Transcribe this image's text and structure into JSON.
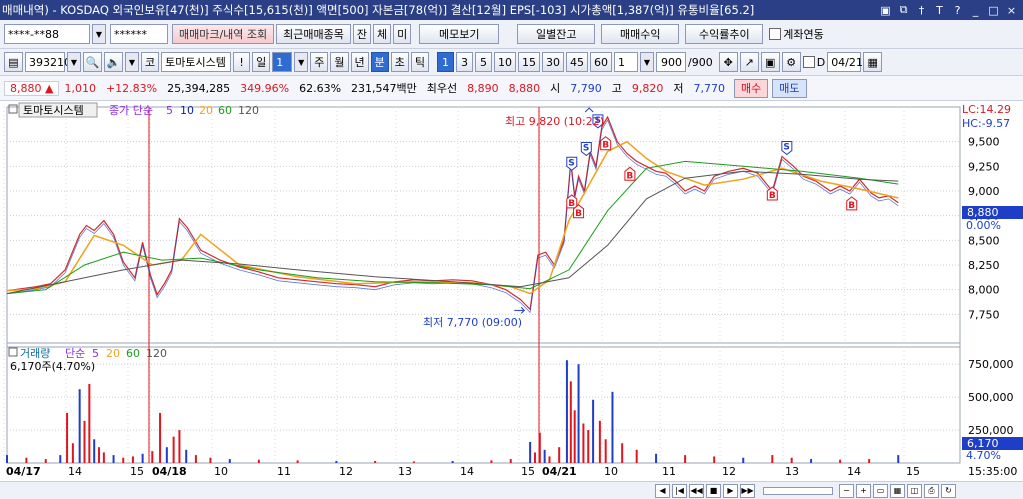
{
  "window": {
    "title": "매매내역) - KOSDAQ 외국인보유[47(천)] 주식수[15,615(천)] 액면[500] 자본금[78(억)] 결산[12월] EPS[-103] 시가총액[1,387(억)] 유통비율[65.2]",
    "buttons": [
      "▣",
      "⧉",
      "†",
      "T",
      "?",
      "_",
      "□",
      "×"
    ]
  },
  "toolbar1": {
    "account": "****-**88",
    "password": "******",
    "btn_trade_mark": "매매마크/내역 조회",
    "btn_recent": "최근매매종목",
    "btn_jan": "잔",
    "btn_che": "체",
    "btn_mi": "미",
    "btn_memo": "메모보기",
    "btn_daily": "일별잔고",
    "btn_profit": "매매수익",
    "btn_trend": "수익률추이",
    "chk_account": "계좌연동"
  },
  "toolbar2": {
    "code": "393210",
    "market": "코",
    "stock_name": "토마토시스템",
    "excl": "!",
    "period_label": "일",
    "period_value": "1",
    "p_week": "주",
    "p_month": "월",
    "p_year": "년",
    "p_min": "분",
    "p_sec": "초",
    "p_tick": "틱",
    "intervals": [
      "1",
      "3",
      "5",
      "10",
      "15",
      "30",
      "45",
      "60"
    ],
    "interval_value": "1",
    "count": "900",
    "count_total": "/900",
    "chk_d": "D",
    "date": "04/21"
  },
  "quote": {
    "price": "8,880",
    "arrow": "▲",
    "change": "1,010",
    "change_pct": "+12.83%",
    "volume": "25,394,285",
    "vol_ratio": "349.96%",
    "turnover": "62.63%",
    "amount": "231,547백만",
    "best_label": "최우선",
    "best_ask": "8,890",
    "best_bid": "8,880",
    "open_label": "시",
    "open": "7,790",
    "high_label": "고",
    "high": "9,820",
    "low_label": "저",
    "low": "7,770",
    "buy": "매수",
    "sell": "매도"
  },
  "chart_data": {
    "type": "line",
    "title": "토마토시스템",
    "price_panel": {
      "legend": {
        "name": "토마토시스템",
        "ma_label": "종가 단순",
        "periods": [
          "5",
          "10",
          "20",
          "60",
          "120"
        ]
      },
      "ylim": [
        7500,
        9750
      ],
      "yticks": [
        "9,500",
        "9,250",
        "9,000",
        "8,750",
        "8,500",
        "8,250",
        "8,000",
        "7,750"
      ],
      "lc_label": "LC:14.29",
      "hc_label": "HC:-9.57",
      "current_label": "8,880",
      "pct_label": "0.00%",
      "high_annot": "최고 9,820 (10:22)",
      "low_annot": "최저 7,770 (09:00)",
      "series": [
        {
          "name": "price",
          "x": [
            0,
            15,
            30,
            45,
            60,
            75,
            82,
            90,
            100,
            110,
            120,
            132,
            140,
            148,
            155,
            163,
            170,
            178,
            186,
            200,
            220,
            240,
            260,
            280,
            300,
            320,
            340,
            360,
            380,
            400,
            420,
            440,
            460,
            480,
            500,
            515,
            530,
            540,
            548,
            556,
            565,
            575,
            582,
            586,
            590,
            596,
            602,
            608,
            614,
            620,
            630,
            640,
            650,
            660,
            670,
            680,
            690,
            700,
            710,
            720,
            730,
            745,
            760,
            775,
            790,
            800,
            812,
            822,
            835,
            850,
            860,
            870,
            880,
            892,
            900,
            910,
            920
          ],
          "y": [
            7990,
            8010,
            8030,
            8060,
            8200,
            8560,
            8650,
            8600,
            8700,
            8560,
            8280,
            8120,
            8480,
            8150,
            7950,
            8070,
            8200,
            8720,
            8630,
            8400,
            8300,
            8230,
            8180,
            8120,
            8100,
            8080,
            8060,
            8050,
            8030,
            8080,
            8100,
            8090,
            8100,
            8090,
            8050,
            8000,
            7900,
            7800,
            8350,
            8380,
            8250,
            8500,
            9300,
            8950,
            9150,
            9000,
            9400,
            9250,
            9650,
            9750,
            9500,
            9380,
            9300,
            9250,
            9200,
            9180,
            9100,
            9000,
            9050,
            9000,
            9150,
            9200,
            9230,
            9180,
            9000,
            9350,
            9250,
            9150,
            9100,
            9000,
            9050,
            9000,
            9120,
            8980,
            8930,
            8950,
            8880
          ]
        },
        {
          "name": "ma20",
          "x": [
            0,
            30,
            60,
            90,
            120,
            150,
            180,
            200,
            240,
            300,
            360,
            420,
            480,
            520,
            540,
            560,
            580,
            600,
            620,
            640,
            660,
            680,
            720,
            760,
            800,
            840,
            880,
            920
          ],
          "y": [
            7990,
            8010,
            8080,
            8550,
            8450,
            8250,
            8300,
            8560,
            8250,
            8130,
            8060,
            8080,
            8070,
            8030,
            7960,
            8100,
            8700,
            9050,
            9400,
            9500,
            9330,
            9200,
            9060,
            9120,
            9230,
            9100,
            9020,
            8930
          ]
        },
        {
          "name": "ma60",
          "x": [
            0,
            40,
            80,
            120,
            160,
            200,
            260,
            320,
            380,
            440,
            500,
            540,
            580,
            620,
            660,
            700,
            760,
            820,
            880,
            920
          ],
          "y": [
            7960,
            8000,
            8250,
            8380,
            8300,
            8320,
            8200,
            8120,
            8080,
            8070,
            8050,
            8010,
            8200,
            8800,
            9230,
            9300,
            9250,
            9200,
            9130,
            9070
          ]
        },
        {
          "name": "ma120",
          "x": [
            0,
            60,
            120,
            180,
            240,
            300,
            380,
            460,
            530,
            580,
            620,
            660,
            700,
            760,
            820,
            880,
            920
          ],
          "y": [
            7960,
            8080,
            8200,
            8300,
            8260,
            8200,
            8130,
            8080,
            8030,
            8120,
            8450,
            8920,
            9130,
            9200,
            9170,
            9120,
            9100
          ]
        }
      ],
      "markers": [
        {
          "type": "S",
          "x": 583,
          "y": 9220
        },
        {
          "type": "B",
          "x": 583,
          "y": 8950
        },
        {
          "type": "B",
          "x": 590,
          "y": 8850
        },
        {
          "type": "S",
          "x": 598,
          "y": 9370
        },
        {
          "type": "S",
          "x": 610,
          "y": 9650
        },
        {
          "type": "B",
          "x": 618,
          "y": 9540
        },
        {
          "type": "B",
          "x": 643,
          "y": 9230
        },
        {
          "type": "B",
          "x": 790,
          "y": 9030
        },
        {
          "type": "S",
          "x": 805,
          "y": 9380
        },
        {
          "type": "B",
          "x": 872,
          "y": 8930
        }
      ]
    },
    "volume_panel": {
      "legend": {
        "name": "거래량",
        "ma_label": "단순",
        "periods": [
          "5",
          "20",
          "60",
          "120"
        ]
      },
      "current_label": "6,170주(4.70%)",
      "ylim": [
        0,
        850000
      ],
      "yticks": [
        "750,000",
        "500,000",
        "250,000"
      ],
      "current_value": "6,170",
      "pct_label": "4.70%",
      "bars": {
        "x": [
          0,
          20,
          40,
          55,
          62,
          68,
          75,
          80,
          85,
          90,
          95,
          100,
          110,
          120,
          130,
          140,
          150,
          158,
          165,
          172,
          178,
          185,
          195,
          210,
          230,
          260,
          300,
          340,
          380,
          420,
          460,
          500,
          520,
          540,
          545,
          550,
          555,
          560,
          570,
          578,
          582,
          586,
          590,
          595,
          600,
          605,
          612,
          618,
          625,
          635,
          650,
          670,
          700,
          730,
          760,
          790,
          810,
          830,
          860,
          890,
          920
        ],
        "y": [
          60000,
          40000,
          30000,
          60000,
          380000,
          150000,
          560000,
          320000,
          600000,
          180000,
          120000,
          80000,
          60000,
          40000,
          50000,
          70000,
          90000,
          380000,
          120000,
          200000,
          250000,
          100000,
          60000,
          40000,
          30000,
          25000,
          20000,
          15000,
          15000,
          12000,
          15000,
          20000,
          30000,
          160000,
          80000,
          230000,
          100000,
          50000,
          120000,
          780000,
          620000,
          400000,
          750000,
          300000,
          250000,
          480000,
          320000,
          180000,
          540000,
          150000,
          100000,
          70000,
          60000,
          50000,
          40000,
          60000,
          40000,
          30000,
          25000,
          30000,
          60000
        ]
      }
    },
    "xaxis": {
      "labels": [
        "04/17",
        "14",
        "15",
        "04/18",
        "10",
        "11",
        "12",
        "13",
        "14",
        "15",
        "04/21",
        "10",
        "11",
        "12",
        "13",
        "14",
        "15"
      ],
      "label_x": [
        4,
        66,
        128,
        150,
        212,
        275,
        337,
        396,
        458,
        519,
        540,
        602,
        660,
        720,
        783,
        845,
        904
      ],
      "bold": [
        "04/17",
        "04/18",
        "04/21"
      ],
      "time": "15:35:00"
    },
    "day_separators_x": [
      149,
      539
    ]
  },
  "colors": {
    "up": "#e0161f",
    "down": "#1f3ec8",
    "ma5": "#8a2be2",
    "ma10": "#0a1f9e",
    "ma20": "#f0a21b",
    "ma60": "#1e9a1e",
    "ma120": "#555555",
    "title_bg": "#2b3f86"
  },
  "bottom": {
    "nav": [
      "◀",
      "|◀",
      "◀◀",
      "■",
      "▶",
      "▶▶"
    ]
  }
}
